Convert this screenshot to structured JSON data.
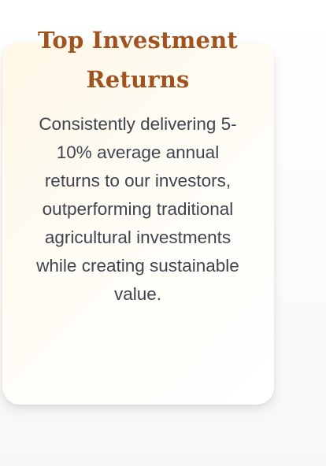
{
  "card": {
    "title": "Top Investment Returns",
    "description": "Consistently delivering 5-10% average annual returns to our investors, outperforming traditional agricultural investments while creating sustainable value."
  }
}
